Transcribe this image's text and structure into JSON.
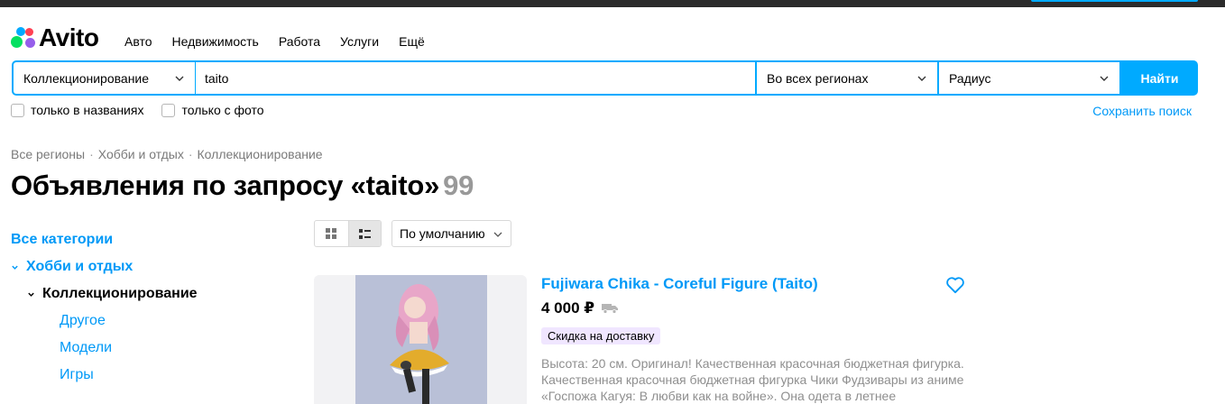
{
  "header": {
    "logo_text": "Avito",
    "nav": [
      "Авто",
      "Недвижимость",
      "Работа",
      "Услуги",
      "Ещё"
    ]
  },
  "search": {
    "category": "Коллекционирование",
    "query": "taito",
    "region": "Во всех регионах",
    "radius": "Радиус",
    "find_label": "Найти"
  },
  "filters": {
    "only_titles": "только в названиях",
    "only_photo": "только с фото",
    "save_search": "Сохранить поиск"
  },
  "breadcrumb": [
    "Все регионы",
    "Хобби и отдых",
    "Коллекционирование"
  ],
  "breadcrumb_sep": "·",
  "page": {
    "title": "Объявления по запросу «taito»",
    "count": "99"
  },
  "sidebar": {
    "all_categories": "Все категории",
    "hobby": "Хобби и отдых",
    "collecting": "Коллекционирование",
    "subcategories": [
      "Другое",
      "Модели",
      "Игры"
    ]
  },
  "toolbar": {
    "sort": "По умолчанию"
  },
  "item": {
    "title": "Fujiwara Chika - Coreful Figure (Taito)",
    "price": "4 000 ₽",
    "badge": "Скидка на доставку",
    "description": "Высота: 20 см. Оригинал! Качественная красочная бюджетная фигурка. Качественная красочная бюджетная фигурка Чики Фудзивары из аниме «Госпожа Кагуя: В любви как на войне». Она одета в летнее"
  },
  "colors": {
    "accent": "#00aaff",
    "link": "#0099f7",
    "badge_bg": "#f0e6ff",
    "muted": "#8f8f8f"
  }
}
